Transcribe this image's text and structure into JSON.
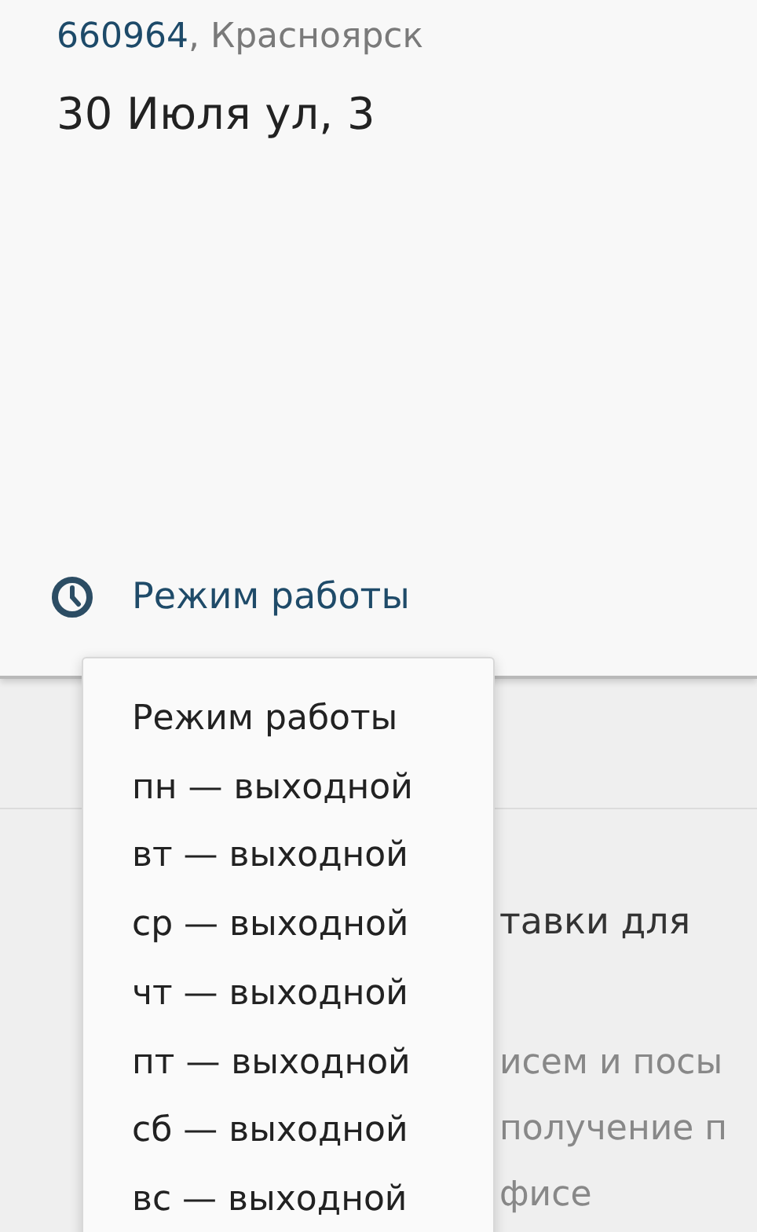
{
  "office": {
    "postcode": "660964",
    "city": ", Красноярск",
    "address": "30 Июля ул, 3",
    "hours_link": "Режим работы"
  },
  "background_text": {
    "heading": "тавки для",
    "lines": [
      "исем и посы",
      "получение п",
      "фисе"
    ]
  },
  "hours_popup": {
    "items": [
      "Режим работы",
      "пн — выходной",
      "вт — выходной",
      "ср — выходной",
      "чт — выходной",
      "пт — выходной",
      "сб — выходной",
      "вс — выходной"
    ]
  }
}
